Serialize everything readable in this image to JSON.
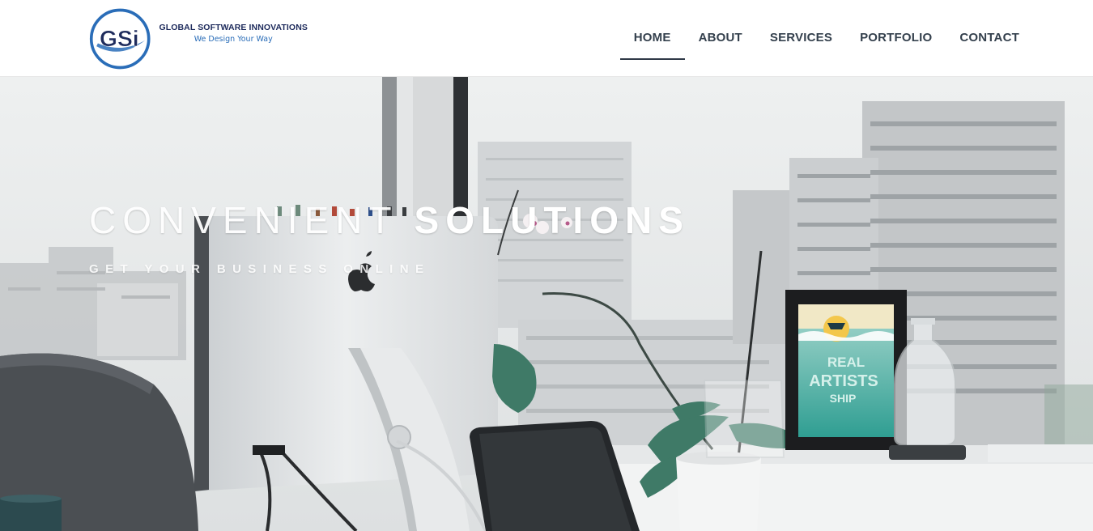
{
  "brand": {
    "monogram": "GSi",
    "name": "GLOBAL SOFTWARE INNOVATIONS",
    "tagline": "We Design Your Way",
    "logo_blue": "#2a6db8",
    "logo_navy": "#1e2b5c"
  },
  "nav": {
    "items": [
      {
        "label": "HOME",
        "active": true
      },
      {
        "label": "ABOUT",
        "active": false
      },
      {
        "label": "SERVICES",
        "active": false
      },
      {
        "label": "PORTFOLIO",
        "active": false
      },
      {
        "label": "CONTACT",
        "active": false
      }
    ],
    "text_color": "#34404d"
  },
  "hero": {
    "headline_light": "CONVENIENT ",
    "headline_bold": "SOLUTIONS",
    "subheadline": "GET YOUR BUSINESS ONLINE",
    "poster_line1": "REAL",
    "poster_line2": "ARTISTS",
    "poster_line3": "SHIP"
  }
}
